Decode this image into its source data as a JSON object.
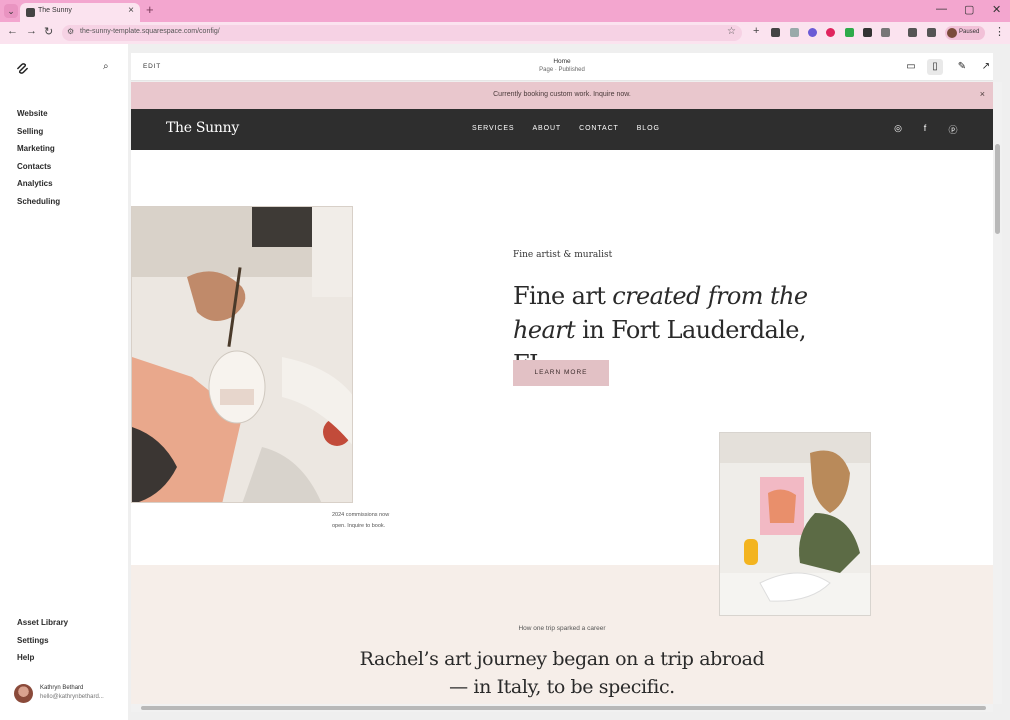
{
  "browser": {
    "tab_title": "The Sunny",
    "url": "the-sunny-template.squarespace.com/config/",
    "profile_label": "Paused"
  },
  "sidebar": {
    "nav": [
      "Website",
      "Selling",
      "Marketing",
      "Contacts",
      "Analytics",
      "Scheduling"
    ],
    "bottom": [
      "Asset Library",
      "Settings",
      "Help"
    ],
    "user_name": "Kathryn Bethard",
    "user_email": "hello@kathrynbethard..."
  },
  "editor": {
    "edit_label": "EDIT",
    "page_name": "Home",
    "page_status": "Page · Published"
  },
  "site": {
    "announcement": "Currently booking custom work. Inquire now.",
    "logo": "The Sunny",
    "nav": [
      "SERVICES",
      "ABOUT",
      "CONTACT",
      "BLOG"
    ],
    "eyebrow": "Fine artist  & muralist",
    "headline_part1": "Fine art ",
    "headline_italic1": "created from the heart",
    "headline_part2": " in Fort Lauderdale, FL",
    "cta": "LEARN MORE",
    "caption_line1": "2024 commissions now",
    "caption_line2": "open. Inquire to book.",
    "section_eyebrow": "How one trip sparked a career",
    "section_line1": "Rachel’s art journey began on a trip abroad",
    "section_line2": "— in Italy, to be specific."
  },
  "colors": {
    "tab_bar": "#f3a6cf",
    "announcement_bg": "#e9c7cd",
    "header_bg": "#2e2e2e",
    "button_bg": "#e2c1c5",
    "section_bg": "#f6eee9"
  }
}
